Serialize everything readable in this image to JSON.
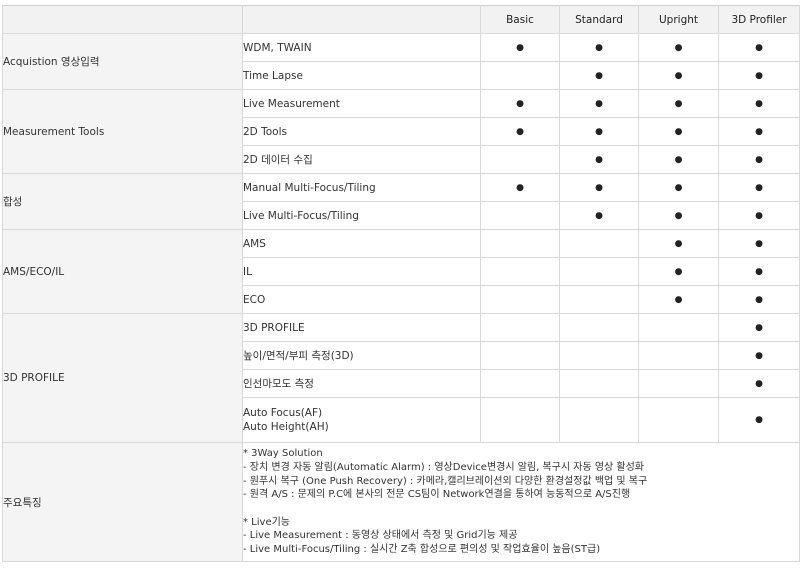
{
  "columns": [
    "Basic",
    "Standard",
    "Upright",
    "3D Profiler"
  ],
  "dot": "●",
  "groups": [
    {
      "category": "Acquistion 영상입력",
      "features": [
        {
          "name": "WDM, TWAIN",
          "marks": [
            true,
            true,
            true,
            true
          ]
        },
        {
          "name": "Time Lapse",
          "marks": [
            false,
            true,
            true,
            true
          ]
        }
      ]
    },
    {
      "category": "Measurement Tools",
      "features": [
        {
          "name": "Live Measurement",
          "marks": [
            true,
            true,
            true,
            true
          ]
        },
        {
          "name": "2D Tools",
          "marks": [
            true,
            true,
            true,
            true
          ]
        },
        {
          "name": "2D 데이터 수집",
          "marks": [
            false,
            true,
            true,
            true
          ]
        }
      ]
    },
    {
      "category": "합성",
      "features": [
        {
          "name": "Manual Multi-Focus/Tiling",
          "marks": [
            true,
            true,
            true,
            true
          ]
        },
        {
          "name": "Live Multi-Focus/Tiling",
          "marks": [
            false,
            true,
            true,
            true
          ]
        }
      ]
    },
    {
      "category": "AMS/ECO/IL",
      "features": [
        {
          "name": "AMS",
          "marks": [
            false,
            false,
            true,
            true
          ]
        },
        {
          "name": "IL",
          "marks": [
            false,
            false,
            true,
            true
          ]
        },
        {
          "name": "ECO",
          "marks": [
            false,
            false,
            true,
            true
          ]
        }
      ]
    },
    {
      "category": "3D PROFILE",
      "features": [
        {
          "name": "3D PROFILE",
          "marks": [
            false,
            false,
            false,
            true
          ]
        },
        {
          "name": "높이/면적/부피 측정(3D)",
          "marks": [
            false,
            false,
            false,
            true
          ]
        },
        {
          "name": "인선마모도 측정",
          "marks": [
            false,
            false,
            false,
            true
          ]
        },
        {
          "name": "Auto Focus(AF)\nAuto Height(AH)",
          "marks": [
            false,
            false,
            false,
            true
          ]
        }
      ]
    }
  ],
  "notes": {
    "category": "주요특징",
    "lines": [
      "* 3Way Solution",
      "- 장치 변경 자동 알림(Automatic Alarm) : 영상Device변경시 알림, 복구시 자동 영상 활성화",
      "- 원푸시 복구 (One Push Recovery) : 카메라,캘리브레이션외 다양한 환경설정값 백업 및 복구",
      "- 원격 A/S : 문제의 P.C에 본사의 전문 CS팀이 Network연결을 통하여 능동적으로 A/S진행",
      "",
      "* Live기능",
      "- Live Measurement : 동영상 상태에서 측정 및 Grid기능 제공",
      "- Live Multi-Focus/Tiling : 실시간 Z축 합성으로 편의성 및 작업효율이 높음(ST급)"
    ]
  }
}
